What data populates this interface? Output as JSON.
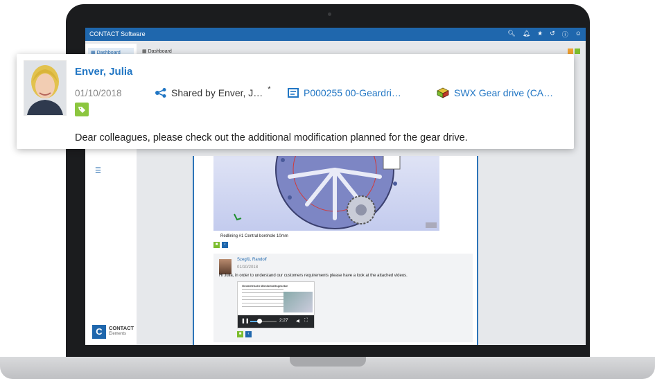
{
  "app": {
    "title": "CONTACT Software"
  },
  "topbar_icons": [
    "search-icon",
    "bell-icon",
    "star-icon",
    "history-icon",
    "info-icon",
    "user-icon"
  ],
  "sidebar": {
    "items": [
      {
        "label": "Dashboard",
        "icon": "dashboard-icon"
      }
    ],
    "list_icon": "list-icon",
    "logo": {
      "name": "CONTACT",
      "sub": "Elements"
    }
  },
  "dashboard": {
    "title": "Dashboard"
  },
  "post": {
    "caption": "Redlining #1 Central borehole 10mm"
  },
  "reply": {
    "author": "Szegfü, Randolf",
    "date": "01/10/2018",
    "text": "Hi Julia, in order to understand our customers requirements please have a look at the attached videos.",
    "video": {
      "title": "Geometrische Ähnlichkeitsgesetze",
      "time": "2:27",
      "progress": 0.35
    }
  },
  "card": {
    "author": "Enver, Julia",
    "date": "01/10/2018",
    "shared_by": "Shared by Enver, J…",
    "shared_marker": "*",
    "document_link": "P000255 00-Geardri…",
    "part_link": "SWX Gear drive (CA…",
    "message": "Dear colleagues, please check out the additional modification planned for the gear drive."
  },
  "colors": {
    "brand_blue": "#1f67ad",
    "link_blue": "#2176c4",
    "tag_green": "#8cc63f",
    "action_green": "#7cbd2e",
    "laptop_bezel": "#1b1c1e"
  }
}
